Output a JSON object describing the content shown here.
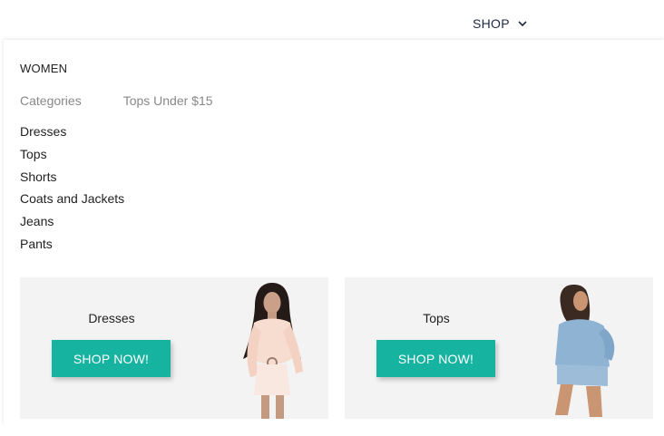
{
  "header": {
    "shop_label": "SHOP"
  },
  "dropdown": {
    "section_title": "WOMEN",
    "tabs": [
      {
        "label": "Categories"
      },
      {
        "label": "Tops Under $15"
      }
    ],
    "categories": [
      {
        "label": "Dresses"
      },
      {
        "label": "Tops"
      },
      {
        "label": "Shorts"
      },
      {
        "label": "Coats and Jackets"
      },
      {
        "label": "Jeans"
      },
      {
        "label": "Pants"
      }
    ],
    "promos": [
      {
        "title": "Dresses",
        "button": "SHOP NOW!"
      },
      {
        "title": "Tops",
        "button": "SHOP NOW!"
      }
    ]
  },
  "colors": {
    "accent": "#16b3a0",
    "nav_text": "#1d2a44",
    "promo_bg": "#f3f3f3"
  }
}
